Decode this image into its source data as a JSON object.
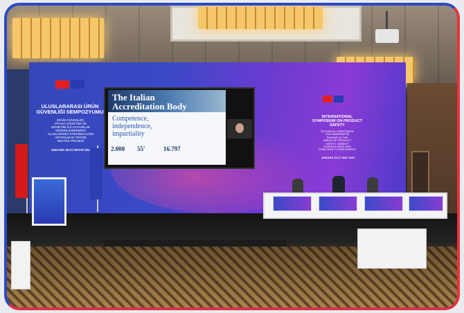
{
  "backdrop_left": {
    "line1": "ULUSLARARASI ÜRÜN",
    "line2": "GÜVENLİĞİ SEMPOZYUMU",
    "sub1": "ÜRÜN GÜVENLİĞİ,",
    "sub2": "PİYASA GÖZETİMİ VE",
    "sub3": "DENETİMİ İLE UYGUNLUK",
    "sub4": "DEĞERLENDİRMESİ",
    "sub5": "ALANLARINDA FARKINDALIĞIN",
    "sub6": "ARTIRILMASI TEKNİK",
    "sub7": "DESTEK PROJESİ",
    "date": "ANKARA 26-27 MAYIS 2021"
  },
  "backdrop_right": {
    "line1": "INTERNATIONAL",
    "line2": "SYMPOSIUM ON PRODUCT",
    "line3": "SAFETY",
    "sub1": "TECHNICAL ASSISTANCE",
    "sub2": "FOR AWARENESS",
    "sub3": "RAISING IN THE",
    "sub4": "AREAS OF PRODUCT",
    "sub5": "SAFETY, MARKET",
    "sub6": "SURVEILLANCE AND",
    "sub7": "CONFORMITY ASSESSMENT",
    "date": "ANKARA 26-27 MAY 2021"
  },
  "slide": {
    "title1": "The Italian",
    "title2": "Accreditation Body",
    "sub": "Competence, independence, impartiality",
    "n1": "2.000",
    "n2": "55'",
    "n3": "16.797"
  },
  "colors": {
    "frame_left": "#2a49c8",
    "frame_right": "#e8323c",
    "backdrop_blue": "#3a49c8",
    "backdrop_purple": "#8a3bd6"
  }
}
